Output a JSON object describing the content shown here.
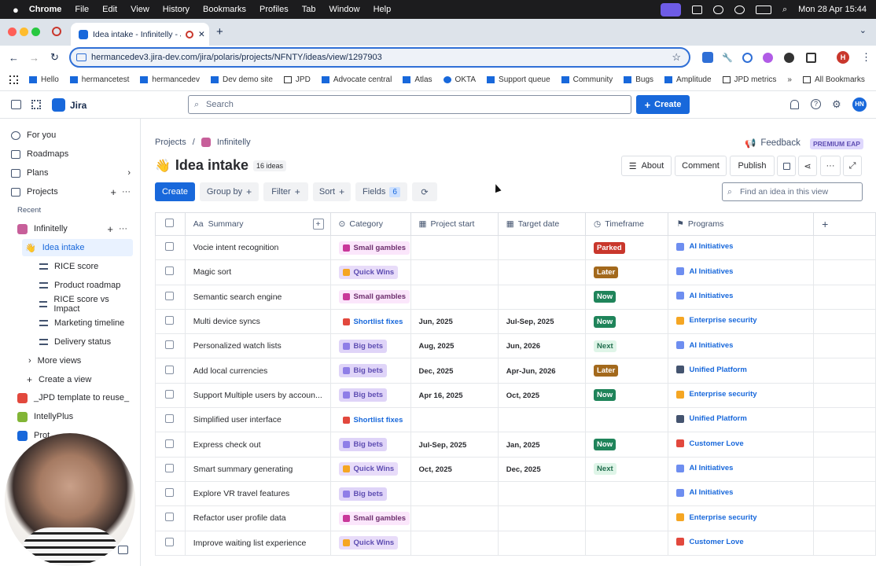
{
  "menubar": {
    "app": "Chrome",
    "menus": [
      "File",
      "Edit",
      "View",
      "History",
      "Bookmarks",
      "Profiles",
      "Tab",
      "Window",
      "Help"
    ],
    "datetime": "Mon 28 Apr  15:44"
  },
  "browser": {
    "tab_title": "Idea intake - Infinitelly - J",
    "url": "hermancedev3.jira-dev.com/jira/polaris/projects/NFNTY/ideas/view/1297903",
    "profile_initial": "H",
    "bookmarks": [
      "Hello",
      "hermancetest",
      "hermancedev",
      "Dev demo site",
      "JPD",
      "Advocate central",
      "Atlas",
      "OKTA",
      "Support queue",
      "Community",
      "Bugs",
      "Amplitude",
      "JPD metrics"
    ],
    "all_bookmarks": "All Bookmarks"
  },
  "jira": {
    "product": "Jira",
    "search_placeholder": "Search",
    "create_label": "Create",
    "user_initials": "HN"
  },
  "sidebar": {
    "top_items": [
      "For you",
      "Roadmaps",
      "Plans",
      "Projects"
    ],
    "recent_label": "Recent",
    "project_name": "Infinitelly",
    "views": [
      "Idea intake",
      "RICE score",
      "Product roadmap",
      "RICE score vs Impact",
      "Marketing timeline",
      "Delivery status"
    ],
    "more_views": "More views",
    "create_view": "Create a view",
    "other_projects": [
      "_JPD template to reuse_",
      "IntellyPlus",
      "Prot..."
    ]
  },
  "page": {
    "breadcrumb_projects": "Projects",
    "breadcrumb_project": "Infinitelly",
    "feedback": "Feedback",
    "badge": "PREMIUM EAP",
    "emoji": "👋",
    "title": "Idea intake",
    "count": "16 ideas",
    "about": "About",
    "comment": "Comment",
    "publish": "Publish",
    "create": "Create",
    "group_by": "Group by",
    "filter": "Filter",
    "sort": "Sort",
    "fields": "Fields",
    "fields_count": "6",
    "find_placeholder": "Find an idea in this view"
  },
  "columns": [
    "Summary",
    "Category",
    "Project start",
    "Target date",
    "Timeframe",
    "Programs"
  ],
  "colors": {
    "small_gambles": "#f3e1f7",
    "quick_wins": "#e7d9f9",
    "shortlist": "#ffffff",
    "big_bets": "#dcd5f5",
    "parked": "#c9372c",
    "later": "#a3691c",
    "now": "#1f845a",
    "next": "#e9f2ff"
  },
  "rows": [
    {
      "summary": "Vocie intent recognition",
      "category": "Small gambles",
      "cat": "small",
      "start": "",
      "target": "",
      "tf": "Parked",
      "program": "AI Initiatives",
      "prog": "ai"
    },
    {
      "summary": "Magic sort",
      "category": "Quick Wins",
      "cat": "quick",
      "start": "",
      "target": "",
      "tf": "Later",
      "program": "AI Initiatives",
      "prog": "ai"
    },
    {
      "summary": "Semantic search engine",
      "category": "Small gambles",
      "cat": "small",
      "start": "",
      "target": "",
      "tf": "Now",
      "program": "AI Initiatives",
      "prog": "ai"
    },
    {
      "summary": "Multi device syncs",
      "category": "Shortlist fixes",
      "cat": "short",
      "start": "Jun, 2025",
      "target": "Jul-Sep, 2025",
      "tf": "Now",
      "program": "Enterprise security",
      "prog": "ent"
    },
    {
      "summary": "Personalized watch lists",
      "category": "Big bets",
      "cat": "big",
      "start": "Aug, 2025",
      "target": "Jun, 2026",
      "tf": "Next",
      "program": "AI Initiatives",
      "prog": "ai"
    },
    {
      "summary": "Add local currencies",
      "category": "Big bets",
      "cat": "big",
      "start": "Dec, 2025",
      "target": "Apr-Jun, 2026",
      "tf": "Later",
      "program": "Unified Platform",
      "prog": "uni"
    },
    {
      "summary": "Support Multiple users by accoun...",
      "category": "Big bets",
      "cat": "big",
      "start": "Apr 16, 2025",
      "target": "Oct, 2025",
      "tf": "Now",
      "program": "Enterprise security",
      "prog": "ent"
    },
    {
      "summary": "Simplified user interface",
      "category": "Shortlist fixes",
      "cat": "short",
      "start": "",
      "target": "",
      "tf": "",
      "program": "Unified Platform",
      "prog": "uni"
    },
    {
      "summary": "Express check out",
      "category": "Big bets",
      "cat": "big",
      "start": "Jul-Sep, 2025",
      "target": "Jan, 2025",
      "tf": "Now",
      "program": "Customer Love",
      "prog": "love"
    },
    {
      "summary": "Smart summary generating",
      "category": "Quick Wins",
      "cat": "quick",
      "start": "Oct, 2025",
      "target": "Dec, 2025",
      "tf": "Next",
      "program": "AI Initiatives",
      "prog": "ai"
    },
    {
      "summary": "Explore VR travel features",
      "category": "Big bets",
      "cat": "big",
      "start": "",
      "target": "",
      "tf": "",
      "program": "AI Initiatives",
      "prog": "ai"
    },
    {
      "summary": "Refactor user profile data",
      "category": "Small gambles",
      "cat": "small",
      "start": "",
      "target": "",
      "tf": "",
      "program": "Enterprise security",
      "prog": "ent"
    },
    {
      "summary": "Improve waiting list experience",
      "category": "Quick Wins",
      "cat": "quick",
      "start": "",
      "target": "",
      "tf": "",
      "program": "Customer Love",
      "prog": "love"
    }
  ]
}
